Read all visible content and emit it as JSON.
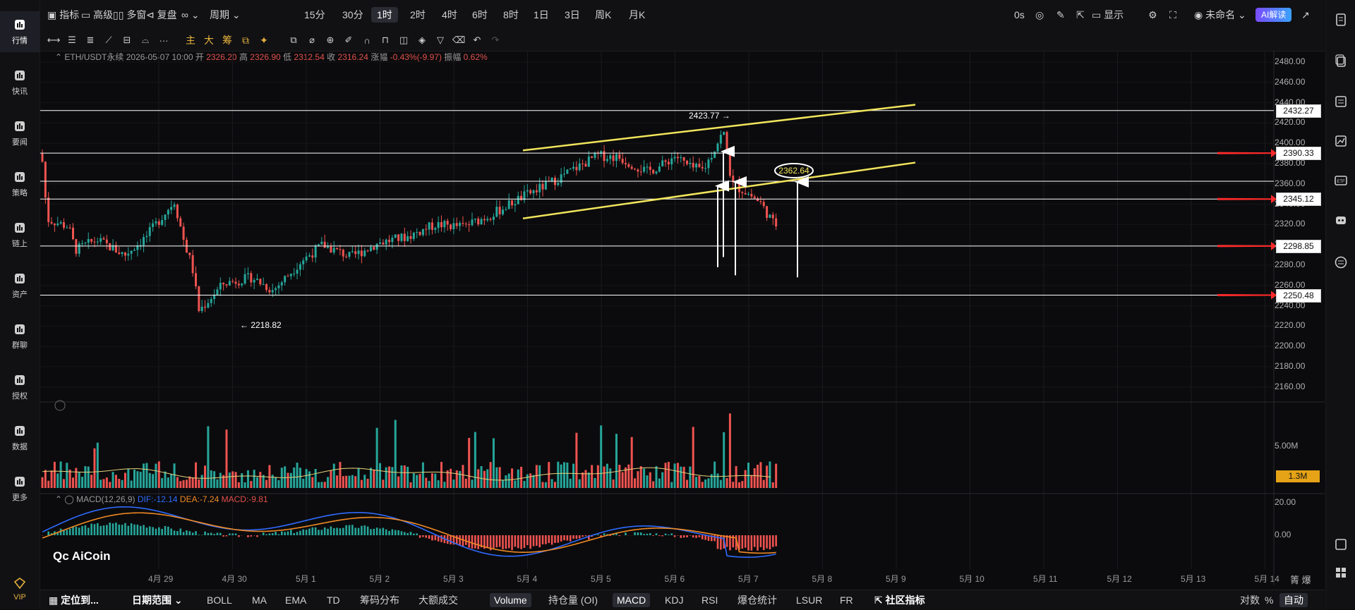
{
  "sidebar": {
    "items": [
      {
        "label": "行情",
        "icon": "bar-chart-icon",
        "active": true
      },
      {
        "label": "快讯",
        "icon": "flash-news-icon"
      },
      {
        "label": "要闻",
        "icon": "news-icon"
      },
      {
        "label": "策略",
        "icon": "robot-icon"
      },
      {
        "label": "链上",
        "icon": "chain-icon"
      },
      {
        "label": "资产",
        "icon": "wallet-icon"
      },
      {
        "label": "群聊",
        "icon": "chat-icon"
      },
      {
        "label": "授权",
        "icon": "key-icon"
      },
      {
        "label": "数据",
        "icon": "data-icon"
      },
      {
        "label": "更多",
        "icon": "grid-icon"
      },
      {
        "label": "VIP",
        "icon": "diamond-icon"
      }
    ]
  },
  "toolbar": {
    "indicator": "指标",
    "advanced": "高级",
    "multi_window": "多窗",
    "replay": "复盘",
    "loop": "∞",
    "period": "周期",
    "timeframes": [
      "15分",
      "30分",
      "1时",
      "2时",
      "4时",
      "6时",
      "8时",
      "1日",
      "3日",
      "周K",
      "月K"
    ],
    "active_timeframe": "1时",
    "countdown": "0s",
    "display": "显示",
    "layout_name": "未命名",
    "ai_button": "AI解读"
  },
  "drawing_tools": {
    "main": "主",
    "big": "大",
    "chip": "筹",
    "more": "···"
  },
  "ohlc": {
    "symbol": "ETH/USDT永续",
    "datetime": "2026-05-07 10:00",
    "open_label": "开",
    "open": "2326.20",
    "high_label": "高",
    "high": "2326.90",
    "low_label": "低",
    "low": "2312.54",
    "close_label": "收",
    "close": "2316.24",
    "change_label": "涨幅",
    "change": "-0.43%(-9.97)",
    "amp_label": "振幅",
    "amp": "0.62%"
  },
  "price_axis": [
    "2480.00",
    "2460.00",
    "2440.00",
    "2420.00",
    "2400.00",
    "2380.00",
    "2360.00",
    "2340.00",
    "2320.00",
    "2300.00",
    "2280.00",
    "2260.00",
    "2240.00",
    "2220.00",
    "2200.00",
    "2180.00",
    "2160.00"
  ],
  "price_tags": [
    {
      "value": 2432.27,
      "text": "2432.27"
    },
    {
      "value": 2390.33,
      "text": "2390.33"
    },
    {
      "value": 2345.12,
      "text": "2345.12"
    },
    {
      "value": 2298.85,
      "text": "2298.85"
    },
    {
      "value": 2250.48,
      "text": "2250.48"
    }
  ],
  "chart_annotations": {
    "high_mark": "2423.77 →",
    "low_mark": "← 2218.82",
    "circle_label": "2362.64",
    "circle_value": 2362.64
  },
  "volume": {
    "axis_label": "5.00M",
    "tag": "1.3M"
  },
  "macd": {
    "title": "MACD(12,26,9)",
    "dif": "DIF:-12.14",
    "dea": "DEA:-7.24",
    "macd": "MACD:-9.81",
    "axis": [
      "20.00",
      "0.00"
    ]
  },
  "watermark": "AiCoin",
  "dates": [
    "4月 29",
    "4月 30",
    "5月 1",
    "5月 2",
    "5月 3",
    "5月 4",
    "5月 5",
    "5月 6",
    "5月 7",
    "5月 8",
    "5月 9",
    "5月 10",
    "5月 11",
    "5月 12",
    "5月 13",
    "5月 14"
  ],
  "bottom_bar": {
    "locate": "定位到...",
    "date_range": "日期范围",
    "tabs": [
      "BOLL",
      "MA",
      "EMA",
      "TD",
      "筹码分布",
      "大额成交"
    ],
    "sub_tabs": [
      "Volume",
      "持仓量 (OI)",
      "MACD",
      "KDJ",
      "RSI",
      "爆仓统计",
      "LSUR",
      "FR"
    ],
    "community": "社区指标",
    "log": "对数",
    "pct": "%",
    "auto": "自动"
  },
  "colors": {
    "up": "#26a69a",
    "down": "#ef5350",
    "trend_line": "#f2e55c",
    "level_line": "#ffffff",
    "arrow": "#ff2a2a",
    "dif_line": "#2f6bff",
    "dea_line": "#f08a24"
  }
}
